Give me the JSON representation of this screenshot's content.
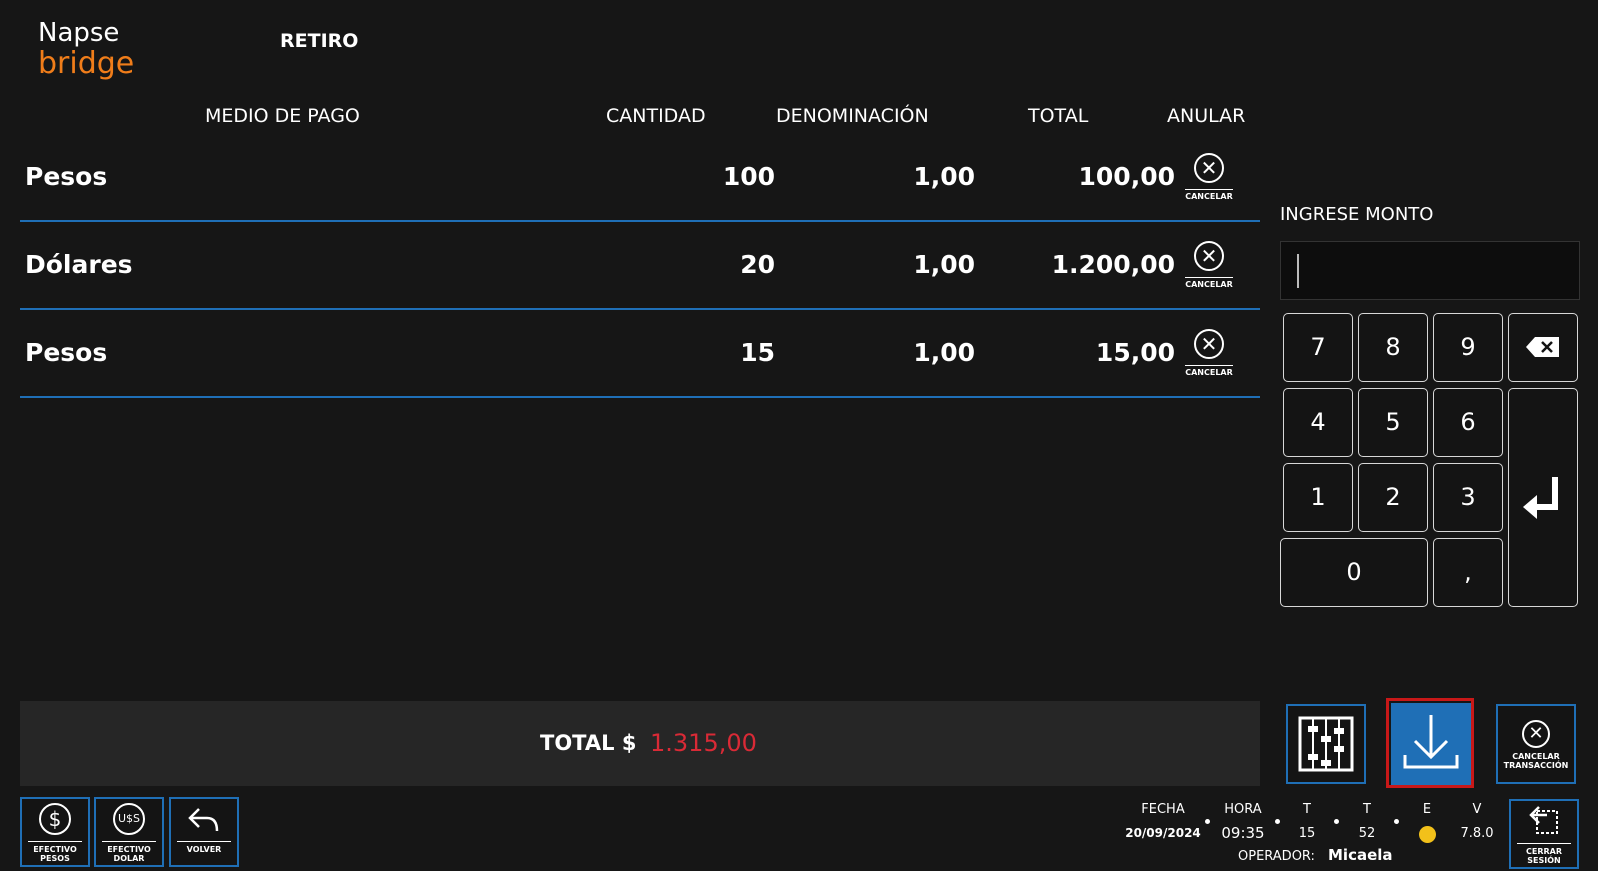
{
  "brand": {
    "line1": "Napse",
    "line2": "bridge"
  },
  "page_title": "RETIRO",
  "table": {
    "headers": {
      "medio": "MEDIO DE PAGO",
      "cantidad": "CANTIDAD",
      "denominacion": "DENOMINACIÓN",
      "total": "TOTAL",
      "anular": "ANULAR"
    },
    "rows": [
      {
        "medio": "Pesos",
        "cantidad": "100",
        "denominacion": "1,00",
        "total": "100,00",
        "cancel_label": "CANCELAR"
      },
      {
        "medio": "Dólares",
        "cantidad": "20",
        "denominacion": "1,00",
        "total": "1.200,00",
        "cancel_label": "CANCELAR"
      },
      {
        "medio": "Pesos",
        "cantidad": "15",
        "denominacion": "1,00",
        "total": "15,00",
        "cancel_label": "CANCELAR"
      }
    ]
  },
  "keypad": {
    "label": "INGRESE MONTO",
    "input_value": "",
    "keys": {
      "k7": "7",
      "k8": "8",
      "k9": "9",
      "k4": "4",
      "k5": "5",
      "k6": "6",
      "k1": "1",
      "k2": "2",
      "k3": "3",
      "k0": "0",
      "comma": ","
    }
  },
  "total": {
    "label": "TOTAL $",
    "value": "1.315,00",
    "value_color": "#d92a36"
  },
  "actions": {
    "cancel_tx": "CANCELAR TRANSACCIÓN"
  },
  "bottom_buttons": {
    "efectivo_pesos": "EFECTIVO PESOS",
    "efectivo_dolar": "EFECTIVO DOLAR",
    "volver": "VOLVER",
    "cerrar_sesion": "CERRAR SESIÓN"
  },
  "status": {
    "fecha_label": "FECHA",
    "fecha": "20/09/2024",
    "hora_label": "HORA",
    "hora": "09:35",
    "t1_label": "T",
    "t1": "15",
    "t2_label": "T",
    "t2": "52",
    "e_label": "E",
    "e_color": "#f2c11a",
    "v_label": "V",
    "v": "7.8.0",
    "operador_label": "OPERADOR:",
    "operador": "Micaela"
  },
  "colors": {
    "accent": "#1f6fb6",
    "highlight": "#c81818",
    "brand_orange": "#f07d1a"
  }
}
